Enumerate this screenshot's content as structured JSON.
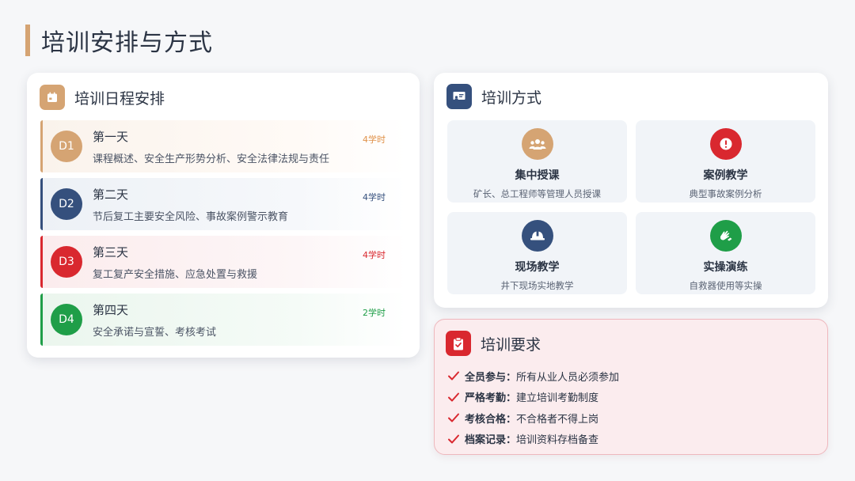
{
  "page_title": "培训安排与方式",
  "schedule": {
    "title": "培训日程安排",
    "days": [
      {
        "badge": "D1",
        "name": "第一天",
        "hours": "4学时",
        "desc": "课程概述、安全生产形势分析、安全法律法规与责任",
        "color": "#d5a473",
        "hours_color": "#e0924a"
      },
      {
        "badge": "D2",
        "name": "第二天",
        "hours": "4学时",
        "desc": "节后复工主要安全风险、事故案例警示教育",
        "color": "#35507d",
        "hours_color": "#35507d"
      },
      {
        "badge": "D3",
        "name": "第三天",
        "hours": "4学时",
        "desc": "复工复产安全措施、应急处置与救援",
        "color": "#d9282f",
        "hours_color": "#d9282f"
      },
      {
        "badge": "D4",
        "name": "第四天",
        "hours": "2学时",
        "desc": "安全承诺与宣誓、考核考试",
        "color": "#1f9e48",
        "hours_color": "#1f9e48"
      }
    ]
  },
  "methods": {
    "title": "培训方式",
    "items": [
      {
        "title": "集中授课",
        "desc": "矿长、总工程师等管理人员授课",
        "icon": "users-icon",
        "color": "#d5a473"
      },
      {
        "title": "案例教学",
        "desc": "典型事故案例分析",
        "icon": "alert-icon",
        "color": "#d9282f"
      },
      {
        "title": "现场教学",
        "desc": "井下现场实地教学",
        "icon": "hardhat-icon",
        "color": "#35507d"
      },
      {
        "title": "实操演练",
        "desc": "自救器使用等实操",
        "icon": "hands-icon",
        "color": "#1f9e48"
      }
    ]
  },
  "requirements": {
    "title": "培训要求",
    "items": [
      {
        "key": "全员参与：",
        "value": "所有从业人员必须参加"
      },
      {
        "key": "严格考勤：",
        "value": "建立培训考勤制度"
      },
      {
        "key": "考核合格：",
        "value": "不合格者不得上岗"
      },
      {
        "key": "档案记录：",
        "value": "培训资料存档备查"
      }
    ]
  }
}
